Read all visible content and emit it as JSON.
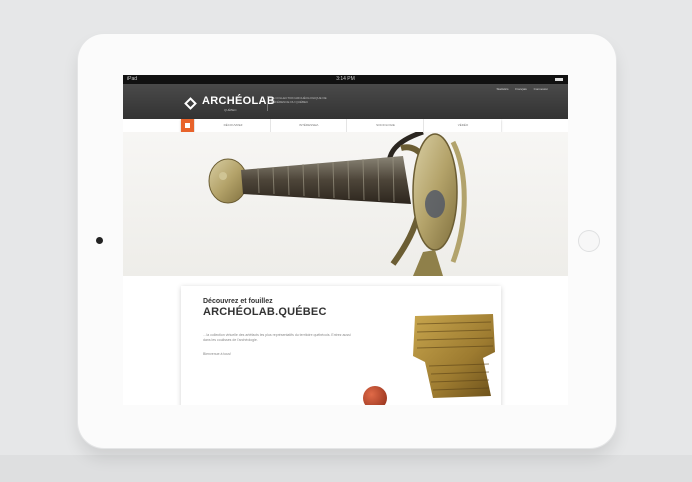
{
  "statusbar": {
    "carrier": "iPad",
    "time": "3:14 PM"
  },
  "header": {
    "logo": "ARCHÉOLAB",
    "logo_sub": "QUÉBEC",
    "tagline": "LA COLLECTION ARCHÉOLOGIQUE DE RÉFÉRENCE DU QUÉBEC",
    "utility": [
      "Statistics",
      "Français",
      "Connexion"
    ]
  },
  "nav": {
    "items": [
      "DÉCOUVREZ",
      "INTÉRESSEZ-",
      "SOCIOLOGIE",
      "VÉDÉO"
    ]
  },
  "hero": {
    "slides": 3,
    "active": 0
  },
  "intro": {
    "heading": "Découvrez et fouillez",
    "title": "ARCHÉOLAB.QUÉBEC",
    "body": "…la collection virtuelle des artéfacts les plus représentatifs du territoire québécois. Entrez aussi dans les coulisses de l'archéologie.",
    "greeting": "Bienvenue à tous!"
  },
  "colors": {
    "accent": "#e8632b",
    "header": "#3b3b3b"
  }
}
